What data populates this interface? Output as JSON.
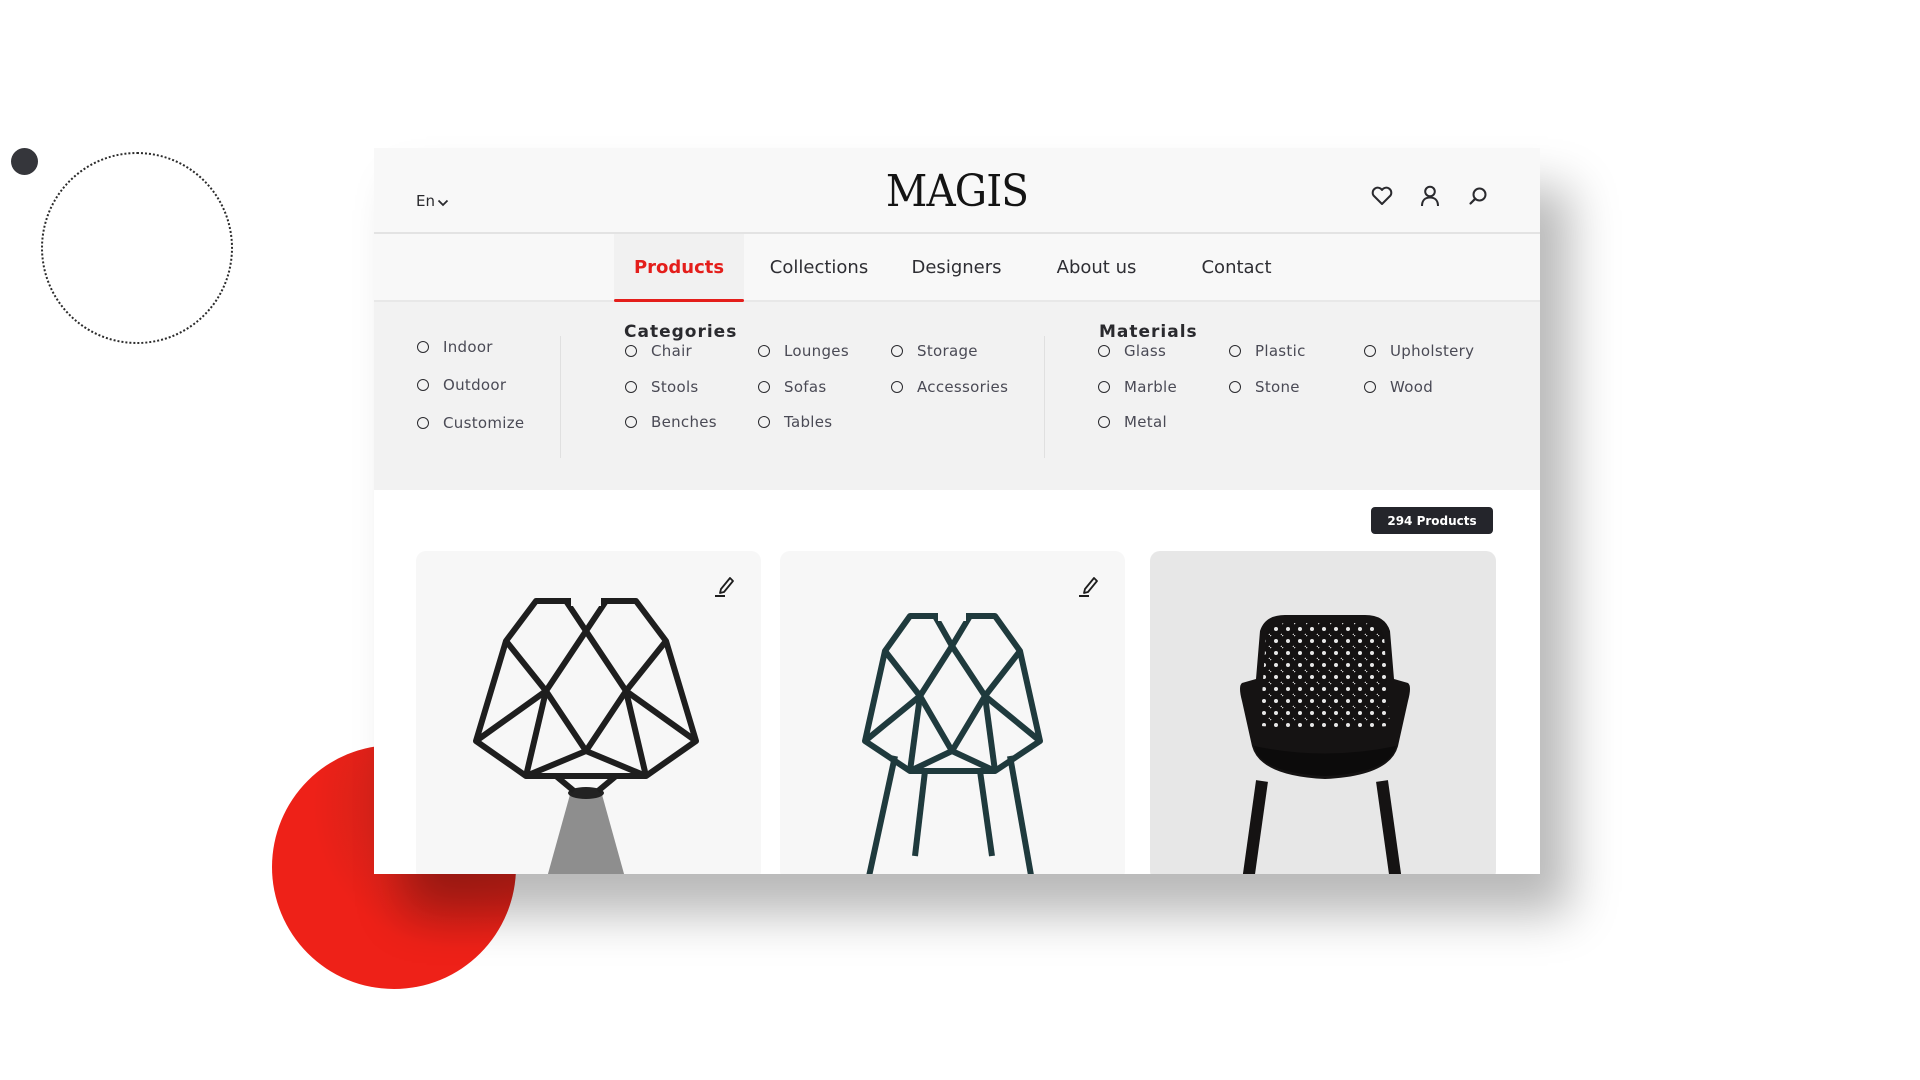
{
  "header": {
    "language": "En",
    "logo": "MAGIS",
    "icons": [
      "heart-icon",
      "user-icon",
      "search-icon"
    ]
  },
  "nav": {
    "items": [
      {
        "label": "Products",
        "active": true
      },
      {
        "label": "Collections",
        "active": false
      },
      {
        "label": "Designers",
        "active": false
      },
      {
        "label": "About us",
        "active": false
      },
      {
        "label": "Contact",
        "active": false
      }
    ]
  },
  "mega_menu": {
    "placement": [
      "Indoor",
      "Outdoor",
      "Customize"
    ],
    "categories": {
      "heading": "Categories",
      "options": [
        "Chair",
        "Lounges",
        "Storage",
        "Stools",
        "Sofas",
        "Accessories",
        "Benches",
        "Tables"
      ]
    },
    "materials": {
      "heading": "Materials",
      "options": [
        "Glass",
        "Plastic",
        "Upholstery",
        "Marble",
        "Stone",
        "Wood",
        "Metal"
      ]
    }
  },
  "products": {
    "count_label": "294 Products",
    "cards": [
      {
        "image": "geometric black chair on concrete base",
        "has_edit": true
      },
      {
        "image": "geometric teal chair with four legs",
        "has_edit": true
      },
      {
        "image": "black perforated armchair",
        "has_edit": false
      }
    ]
  },
  "colors": {
    "accent": "#e41e1b",
    "badge": "#24252b",
    "header_bg": "#f8f8f8",
    "menu_bg": "#f2f2f2"
  }
}
